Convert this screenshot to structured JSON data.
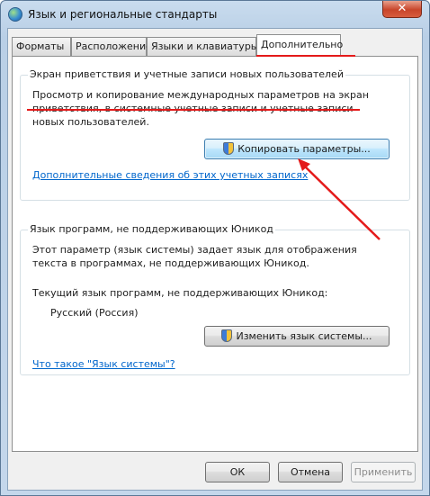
{
  "window": {
    "title": "Язык и региональные стандарты",
    "close_label": "✕"
  },
  "tabs": [
    {
      "label": "Форматы"
    },
    {
      "label": "Расположение"
    },
    {
      "label": "Языки и клавиатуры"
    },
    {
      "label": "Дополнительно"
    }
  ],
  "welcome_group": {
    "title": "Экран приветствия и учетные записи новых пользователей",
    "description": "Просмотр и копирование международных параметров на экран приветствия, в системные учетные записи и учетные записи новых пользователей.",
    "copy_button_label": "Копировать параметры...",
    "more_info_link": "Дополнительные сведения об этих учетных записях"
  },
  "nonunicode_group": {
    "title": "Язык программ, не поддерживающих Юникод",
    "description": "Этот параметр (язык системы) задает язык для отображения текста в программах, не поддерживающих Юникод.",
    "current_label": "Текущий язык программ, не поддерживающих Юникод:",
    "current_value": "Русский (Россия)",
    "change_button_label": "Изменить язык системы...",
    "what_is_link": "Что такое \"Язык системы\"?"
  },
  "footer": {
    "ok_label": "ОК",
    "cancel_label": "Отмена",
    "apply_label": "Применить"
  },
  "colors": {
    "annotation_red": "#e41a1a",
    "link_blue": "#0066cc"
  }
}
